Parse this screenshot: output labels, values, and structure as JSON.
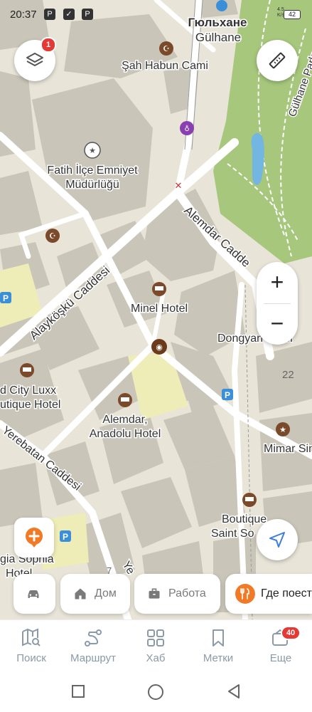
{
  "status_bar": {
    "time": "20:37",
    "network": "4.5\nK/s",
    "battery": "42"
  },
  "map": {
    "labels": {
      "gulhane_ru": "Гюльхане",
      "gulhane": "Gülhane",
      "sah_habun": "Şah Habun Cami",
      "fatih_1": "Fatih İlçe Emniyet",
      "fatih_2": "Müdürlüğü",
      "gulhane_park": "Gülhane Parkı",
      "alemdar_cad": "Alemdar Cadde",
      "alaykosku": "Alayköşkü Caddesi",
      "minel": "Minel Hotel",
      "dongya": "Dongyan Hotel",
      "num22": "22",
      "luxx_1": "d City Luxx",
      "luxx_2": "utique Hotel",
      "alemdar_h1": "Alemdar,",
      "alemdar_h2": "Anadolu Hotel",
      "mimar": "Mimar Sina",
      "yerebatan": "Yerebatan Caddesi",
      "boutique_1": "Boutique",
      "boutique_2": "Saint So",
      "sophia_1": "gia Sophia",
      "sophia_2": "Hotel",
      "ye": "Ye",
      "num7": "7"
    },
    "colors": {
      "land": "#e8e4d8",
      "building": "#c9c5b8",
      "road": "#ffffff",
      "park": "#a6c77c",
      "water": "#74b6e2",
      "accent": "#f07a26"
    }
  },
  "controls": {
    "layers_badge": "1",
    "zoom_in": "+",
    "zoom_out": "−"
  },
  "chips": {
    "car": "",
    "home": "Дом",
    "work": "Работа",
    "food": "Где поест"
  },
  "tabs": [
    {
      "label": "Поиск",
      "icon": "map-search-icon"
    },
    {
      "label": "Маршрут",
      "icon": "route-icon"
    },
    {
      "label": "Хаб",
      "icon": "hub-grid-icon"
    },
    {
      "label": "Метки",
      "icon": "bookmarks-icon"
    },
    {
      "label": "Еще",
      "icon": "more-icon",
      "badge": "40"
    }
  ]
}
